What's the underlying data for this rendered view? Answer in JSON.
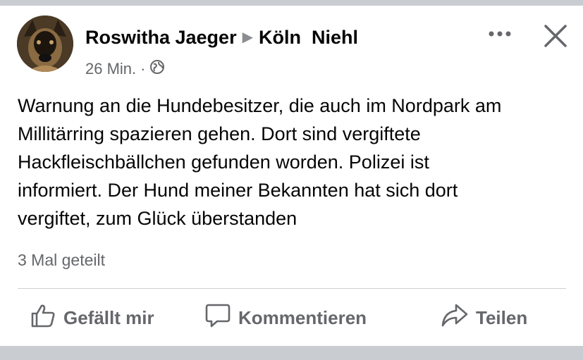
{
  "post": {
    "author": "Roswitha Jaeger",
    "group": "Köln  Niehl",
    "timestamp": "26 Min.",
    "separator": "·",
    "audience_icon": "globe-icon",
    "text_lines": [
      "Warnung an die Hundebesitzer, die auch im Nordpark am",
      "Millitärring spazieren gehen. Dort sind vergiftete",
      "Hackfleischbällchen gefunden worden. Polizei ist",
      "informiert. Der Hund meiner Bekannten hat sich dort",
      "vergiftet, zum Glück überstanden"
    ],
    "shares": "3 Mal geteilt"
  },
  "actions": {
    "like_label": "Gefällt mir",
    "comment_label": "Kommentieren",
    "share_label": "Teilen"
  },
  "colors": {
    "background_band": "#c9ccd1",
    "text_primary": "#050505",
    "text_secondary": "#65676b",
    "divider": "#ced0d4"
  }
}
